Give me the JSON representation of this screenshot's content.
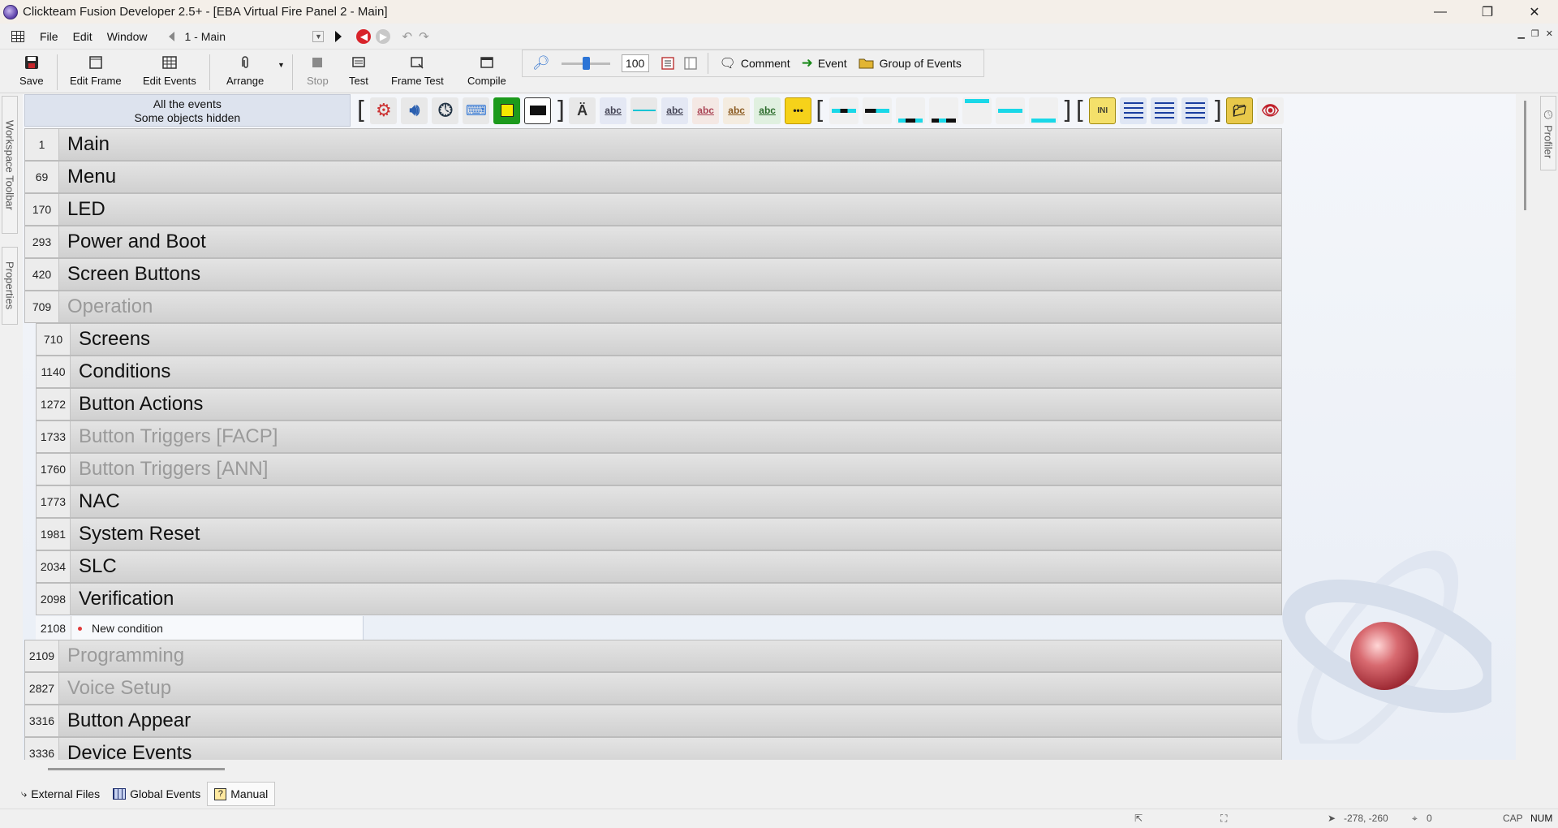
{
  "window": {
    "title": "Clickteam Fusion Developer 2.5+ - [EBA Virtual Fire Panel 2 - Main]",
    "minimize": "—",
    "restore": "❐",
    "close": "✕"
  },
  "menu": {
    "items": [
      "File",
      "Edit",
      "Window"
    ],
    "frame_selector": "1 - Main"
  },
  "toolbar": {
    "save": "Save",
    "edit_frame": "Edit Frame",
    "edit_events": "Edit Events",
    "arrange": "Arrange",
    "stop": "Stop",
    "test": "Test",
    "frame_test": "Frame Test",
    "compile": "Compile",
    "zoom_value": "100",
    "comment": "Comment",
    "event": "Event",
    "group_of_events": "Group of Events"
  },
  "sidebar_left": {
    "workspace_toolbar": "Workspace Toolbar",
    "properties": "Properties"
  },
  "sidebar_right": {
    "profiler": "Profiler"
  },
  "editor_header": {
    "line1": "All the events",
    "line2": "Some objects hidden"
  },
  "groups": [
    {
      "num": "1",
      "name": "Main",
      "disabled": false,
      "indent": 0
    },
    {
      "num": "69",
      "name": "Menu",
      "disabled": false,
      "indent": 0
    },
    {
      "num": "170",
      "name": "LED",
      "disabled": false,
      "indent": 0
    },
    {
      "num": "293",
      "name": "Power and Boot",
      "disabled": false,
      "indent": 0
    },
    {
      "num": "420",
      "name": "Screen Buttons",
      "disabled": false,
      "indent": 0
    },
    {
      "num": "709",
      "name": "Operation",
      "disabled": true,
      "indent": 0
    },
    {
      "num": "710",
      "name": "Screens",
      "disabled": false,
      "indent": 1
    },
    {
      "num": "1140",
      "name": "Conditions",
      "disabled": false,
      "indent": 1
    },
    {
      "num": "1272",
      "name": "Button Actions",
      "disabled": false,
      "indent": 1
    },
    {
      "num": "1733",
      "name": "Button Triggers [FACP]",
      "disabled": true,
      "indent": 1
    },
    {
      "num": "1760",
      "name": "Button Triggers [ANN]",
      "disabled": true,
      "indent": 1
    },
    {
      "num": "1773",
      "name": "NAC",
      "disabled": false,
      "indent": 1
    },
    {
      "num": "1981",
      "name": "System Reset",
      "disabled": false,
      "indent": 1
    },
    {
      "num": "2034",
      "name": "SLC",
      "disabled": false,
      "indent": 1
    },
    {
      "num": "2098",
      "name": "Verification",
      "disabled": false,
      "indent": 1
    }
  ],
  "new_condition": {
    "num": "2108",
    "label": "New condition"
  },
  "groups_after": [
    {
      "num": "2109",
      "name": "Programming",
      "disabled": true
    },
    {
      "num": "2827",
      "name": "Voice Setup",
      "disabled": true
    },
    {
      "num": "3316",
      "name": "Button Appear",
      "disabled": false
    },
    {
      "num": "3336",
      "name": "Device Events",
      "disabled": false
    }
  ],
  "bottom_tabs": [
    "External Files",
    "Global Events",
    "Manual"
  ],
  "status": {
    "coords": "-278, -260",
    "count": "0",
    "cap": "CAP",
    "num": "NUM"
  }
}
